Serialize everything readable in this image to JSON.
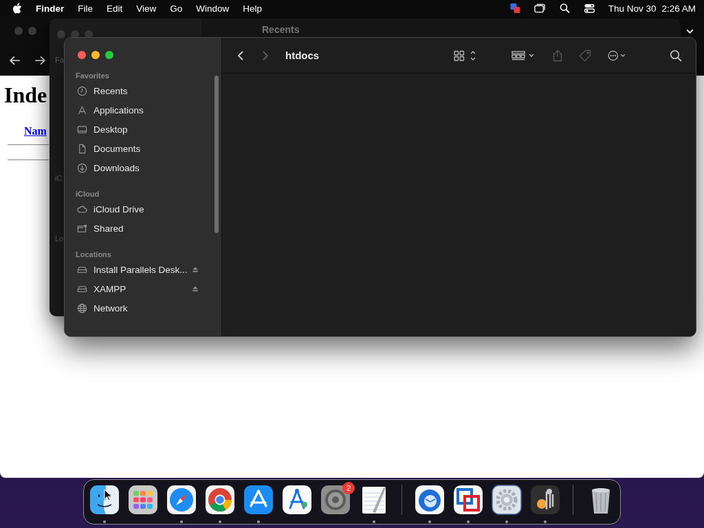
{
  "menu_bar": {
    "app": "Finder",
    "menus": [
      "File",
      "Edit",
      "View",
      "Go",
      "Window",
      "Help"
    ],
    "date": "Thu Nov 30",
    "time": "2:26 AM"
  },
  "browser_window": {
    "heading": "Inde",
    "link": "Nam"
  },
  "back_finder_window": {
    "title": "Recents",
    "sidebar_fragments": [
      "Fa",
      "iC",
      "Lo"
    ]
  },
  "finder_window": {
    "title": "htdocs",
    "back_enabled": true,
    "forward_enabled": false,
    "sidebar": [
      {
        "heading": "Favorites",
        "items": [
          {
            "label": "Recents",
            "kind": "clock",
            "selected": false,
            "eject": false
          },
          {
            "label": "Applications",
            "kind": "apps",
            "selected": false,
            "eject": false
          },
          {
            "label": "Desktop",
            "kind": "desktop",
            "selected": false,
            "eject": false
          },
          {
            "label": "Documents",
            "kind": "doc",
            "selected": false,
            "eject": false
          },
          {
            "label": "Downloads",
            "kind": "download",
            "selected": false,
            "eject": false
          }
        ]
      },
      {
        "heading": "iCloud",
        "items": [
          {
            "label": "iCloud Drive",
            "kind": "cloud",
            "selected": false,
            "eject": false
          },
          {
            "label": "Shared",
            "kind": "shared",
            "selected": false,
            "eject": false
          }
        ]
      },
      {
        "heading": "Locations",
        "items": [
          {
            "label": "Install Parallels Desk...",
            "kind": "drive",
            "selected": false,
            "eject": true
          },
          {
            "label": "XAMPP",
            "kind": "drive",
            "selected": false,
            "eject": true
          },
          {
            "label": "Network",
            "kind": "globe",
            "selected": false,
            "eject": false
          }
        ]
      }
    ]
  },
  "dock": {
    "sections": [
      {
        "apps": [
          {
            "kind": "finder",
            "running": true
          },
          {
            "kind": "launchpad",
            "running": false
          },
          {
            "kind": "safari",
            "running": true
          },
          {
            "kind": "chrome",
            "running": true
          },
          {
            "kind": "appstore",
            "running": true
          },
          {
            "kind": "compass",
            "running": false
          },
          {
            "kind": "settings",
            "running": false,
            "badge": "2"
          },
          {
            "kind": "notepad",
            "running": true
          }
        ]
      },
      {
        "apps": [
          {
            "kind": "thunderbird",
            "running": true
          },
          {
            "kind": "vmware",
            "running": true
          },
          {
            "kind": "gear",
            "running": true
          },
          {
            "kind": "keychain",
            "running": true
          }
        ]
      },
      {
        "apps": [
          {
            "kind": "trash",
            "running": false
          }
        ]
      }
    ]
  }
}
